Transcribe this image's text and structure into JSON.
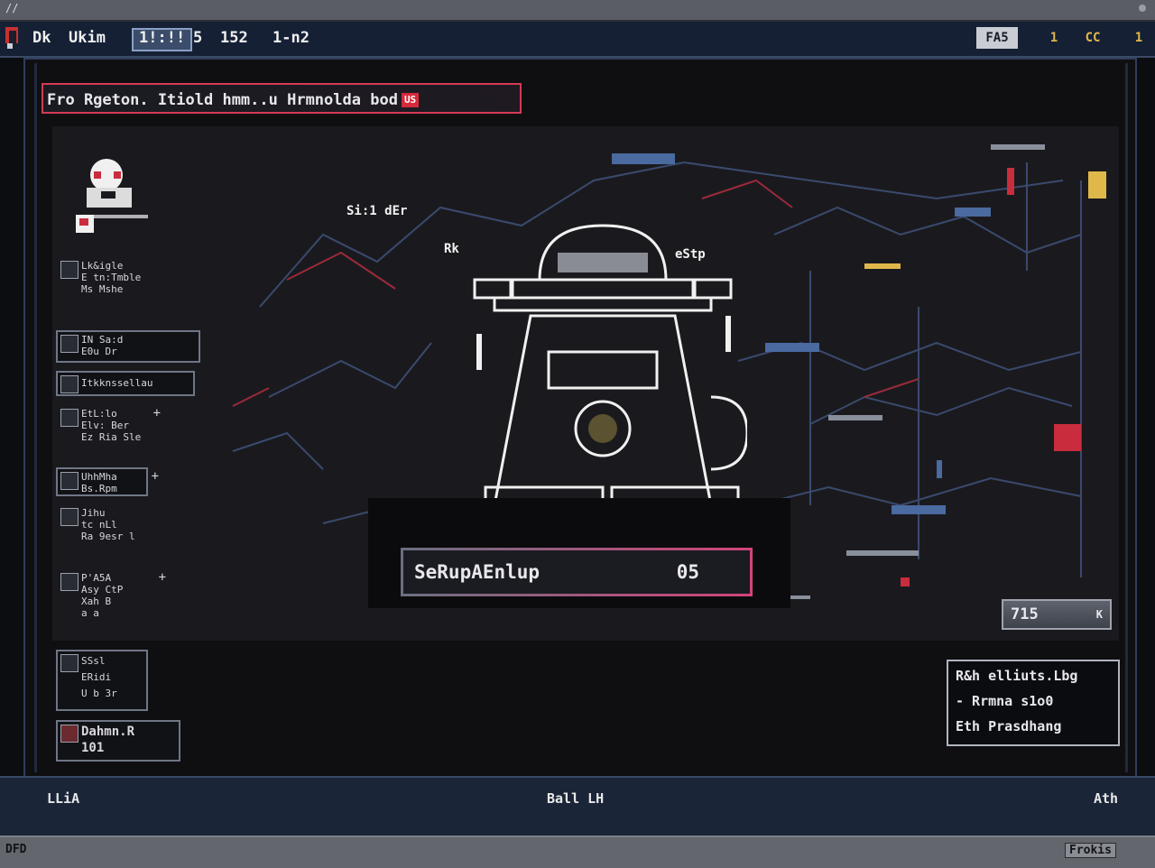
{
  "window": {
    "title": "//"
  },
  "hud": {
    "mode": "Dk",
    "label": "Ukim",
    "box": "1!:!!",
    "stat_a": "5",
    "stat_b": "152",
    "stat_c": "1-n2",
    "right_btn_1": "FA5",
    "right_btn_2": "1",
    "right_btn_3": "CC",
    "right_btn_4": "1"
  },
  "objective": {
    "text": "Fro Rgeton. Itiold hmm..u Hrmnolda bod",
    "badge": "US"
  },
  "sidebar": {
    "items": [
      {
        "line1": "Lk&igle",
        "line2": "E tn:Tmble",
        "line3": "Ms Mshe"
      },
      {
        "line1": "IN Sa:d",
        "line2": "E0u Dr"
      },
      {
        "line1": "Itkknssellau"
      },
      {
        "line1": "EtL:lo",
        "line2": "Elv: Ber",
        "line3": "Ez Ria Sle",
        "plus": "+"
      },
      {
        "line1": "UhhMha",
        "line2": "Bs.Rpm",
        "plus": "+"
      },
      {
        "line1": "Jihu",
        "line2": "tc nLl",
        "line3": "Ra 9esr l"
      },
      {
        "line1": "P'A5A",
        "line2": "Asy CtP",
        "line3": "Xah B",
        "line4": "a a",
        "plus": "+"
      },
      {
        "line1": "SSsl",
        "line2": "ERidi",
        "line3": "U b 3r"
      },
      {
        "line1": "Dahmn.R",
        "line2": "101"
      }
    ]
  },
  "scene": {
    "float_1": "Si:1 dEr",
    "float_2": "Rk",
    "float_3": "eStp"
  },
  "dialog": {
    "text": "SeRupAEnlup",
    "value": "05"
  },
  "miniwin": {
    "text": "715",
    "close": "K"
  },
  "info": {
    "line1": "R&h elliuts.Lbg",
    "line2": "- Rrmna s1o0",
    "line3": "Eth Prasdhang"
  },
  "bottom": {
    "left": "LLiA",
    "center": "Ball LH",
    "right": "Ath"
  },
  "status": {
    "left": "DFD",
    "right": "Frokis"
  },
  "colors": {
    "accent": "#d43a55",
    "hud_bg": "#152035",
    "panel_border": "#9ea3ad"
  }
}
